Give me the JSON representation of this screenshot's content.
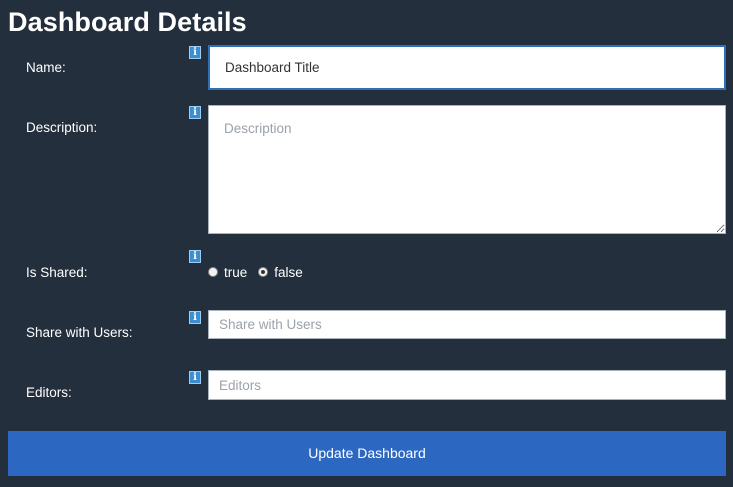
{
  "page": {
    "title": "Dashboard Details"
  },
  "form": {
    "name": {
      "label": "Name:",
      "value": "Dashboard Title",
      "info_icon": "info-icon"
    },
    "description": {
      "label": "Description:",
      "placeholder": "Description",
      "info_icon": "info-icon"
    },
    "is_shared": {
      "label": "Is Shared:",
      "options": [
        {
          "label": "true",
          "checked": false
        },
        {
          "label": "false",
          "checked": true
        }
      ],
      "info_icon": "info-icon"
    },
    "share_with_users": {
      "label": "Share with Users:",
      "placeholder": "Share with Users",
      "info_icon": "info-icon"
    },
    "editors": {
      "label": "Editors:",
      "placeholder": "Editors",
      "info_icon": "info-icon"
    },
    "submit_label": "Update Dashboard"
  },
  "colors": {
    "background": "#232f3c",
    "button": "#2c68c2",
    "info_icon": "#3b8fd0",
    "focus_border": "#2f6fb8"
  },
  "glyphs": {
    "info": "i"
  }
}
